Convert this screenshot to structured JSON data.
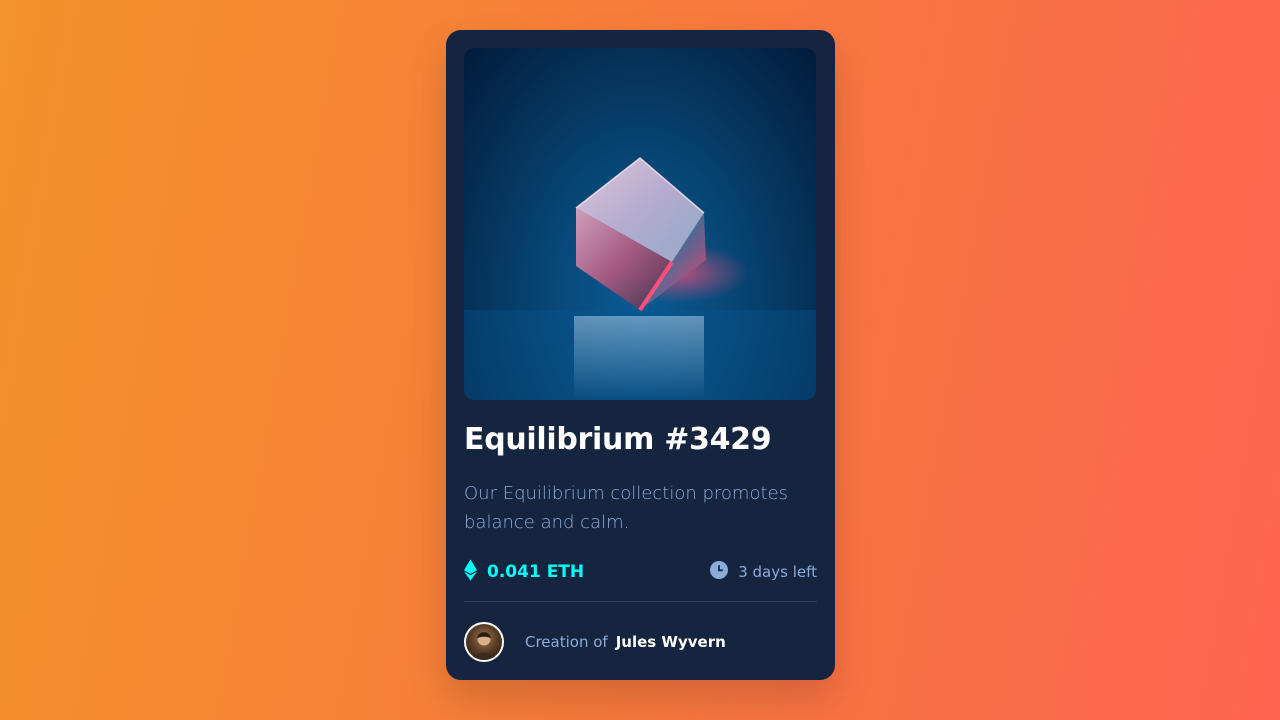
{
  "card": {
    "title": "Equilibrium #3429",
    "description": "Our Equilibrium collection promotes balance and calm.",
    "price": "0.041 ETH",
    "time_left": "3 days left",
    "creator_label": "Creation of",
    "creator_name": "Jules Wyvern"
  },
  "icons": {
    "price": "ethereum-icon",
    "time": "clock-icon",
    "avatar": "creator-avatar"
  },
  "colors": {
    "background_start": "#f4922b",
    "background_end": "#fd6450",
    "card": "#15253f",
    "accent_cyan": "#00fff8",
    "soft_blue": "#8bacd9",
    "white": "#ffffff"
  }
}
